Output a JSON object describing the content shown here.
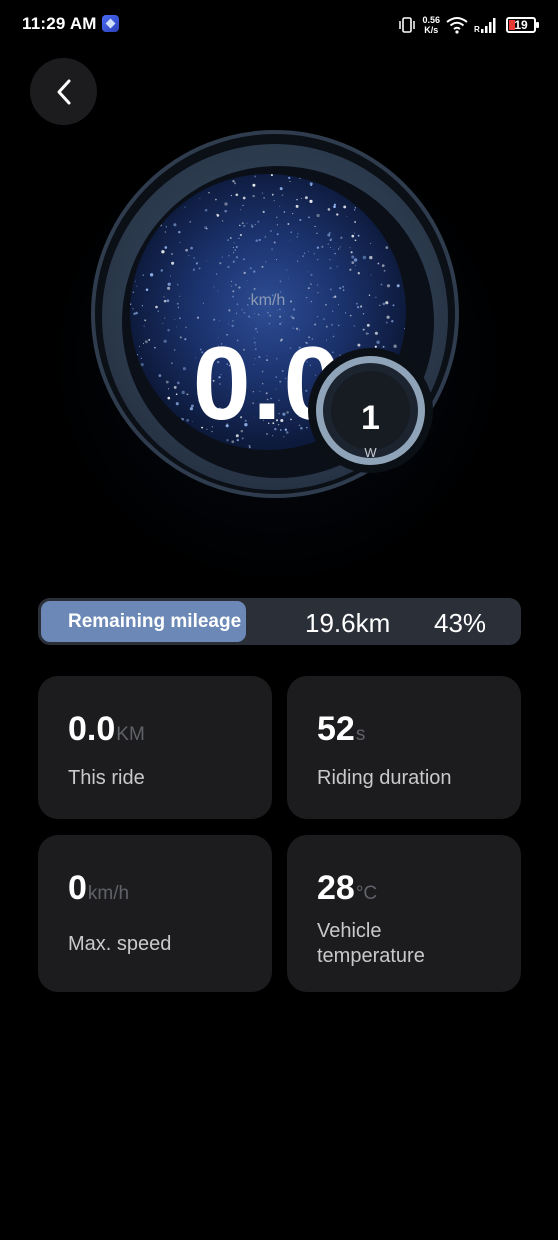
{
  "status_bar": {
    "time": "11:29 AM",
    "net_speed_value": "0.56",
    "net_speed_unit": "K/s",
    "battery": "19",
    "icons": [
      "app-notification-icon",
      "vibrate-icon",
      "wifi-icon",
      "signal-icon",
      "battery-icon"
    ]
  },
  "nav": {
    "back_icon": "chevron-left-icon"
  },
  "speedometer": {
    "unit": "km/h",
    "speed": "0.0"
  },
  "power": {
    "value": "1",
    "unit": "W"
  },
  "mileage": {
    "label": "Remaining mileage",
    "distance": "19.6km",
    "percent_text": "43%",
    "percent": 43
  },
  "stats": [
    {
      "value": "0.0",
      "unit": "KM",
      "label": "This ride"
    },
    {
      "value": "52",
      "unit": "s",
      "label": "Riding duration"
    },
    {
      "value": "0",
      "unit": "km/h",
      "label": "Max. speed"
    },
    {
      "value": "28",
      "unit": "°C",
      "label": "Vehicle temperature"
    }
  ],
  "colors": {
    "background": "#000000",
    "card": "#1c1c1e",
    "mileage_fill": "#6b88b6",
    "dial_blue": "#1c3470",
    "battery_low": "#e53935"
  }
}
